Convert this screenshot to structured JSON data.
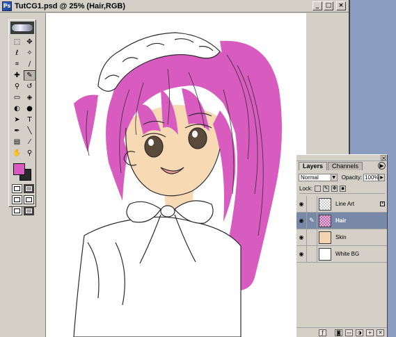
{
  "document": {
    "title": "TutCG1.psd @ 25% (Hair,RGB)",
    "app_icon": "photoshop-app-icon",
    "buttons": {
      "minimize": "_",
      "maximize": "□",
      "close": "×"
    }
  },
  "toolbox": {
    "tools": [
      {
        "name": "marquee",
        "glyph": "⬚"
      },
      {
        "name": "move",
        "glyph": "✥"
      },
      {
        "name": "lasso",
        "glyph": "ℓ"
      },
      {
        "name": "magic-wand",
        "glyph": "✧"
      },
      {
        "name": "crop",
        "glyph": "⌗"
      },
      {
        "name": "slice",
        "glyph": "∕"
      },
      {
        "name": "healing-brush",
        "glyph": "✚"
      },
      {
        "name": "brush",
        "glyph": "✎"
      },
      {
        "name": "clone-stamp",
        "glyph": "⚲"
      },
      {
        "name": "history-brush",
        "glyph": "↺"
      },
      {
        "name": "eraser",
        "glyph": "▭"
      },
      {
        "name": "paint-bucket",
        "glyph": "◈"
      },
      {
        "name": "dodge",
        "glyph": "◐"
      },
      {
        "name": "blur",
        "glyph": "●"
      },
      {
        "name": "path-selection",
        "glyph": "➤"
      },
      {
        "name": "type",
        "glyph": "T"
      },
      {
        "name": "pen",
        "glyph": "✒"
      },
      {
        "name": "line",
        "glyph": "╲"
      },
      {
        "name": "notes",
        "glyph": "▤"
      },
      {
        "name": "eyedropper",
        "glyph": "⁄"
      },
      {
        "name": "hand",
        "glyph": "✋"
      },
      {
        "name": "zoom",
        "glyph": "⚲"
      }
    ],
    "foreground_color": "#d85cc0",
    "background_color": "#2a2a2a"
  },
  "layers_palette": {
    "tabs": [
      "Layers",
      "Channels"
    ],
    "blend_mode": "Normal",
    "opacity_label": "Opacity:",
    "opacity_value": "100%",
    "lock_label": "Lock:",
    "layers": [
      {
        "name": "Line Art",
        "visible": true,
        "selected": false,
        "locked": true,
        "thumb": "checker"
      },
      {
        "name": "Hair",
        "visible": true,
        "selected": true,
        "locked": false,
        "thumb": "checker"
      },
      {
        "name": "Skin",
        "visible": true,
        "selected": false,
        "locked": false,
        "thumb": "skin"
      },
      {
        "name": "White BG",
        "visible": true,
        "selected": false,
        "locked": false,
        "thumb": "white"
      }
    ]
  },
  "colors": {
    "hair": "#d85cc0",
    "skin": "#f7d9b4",
    "line": "#2a2a2a",
    "desktop": "#8a9cbf",
    "selection": "#7889a8"
  }
}
